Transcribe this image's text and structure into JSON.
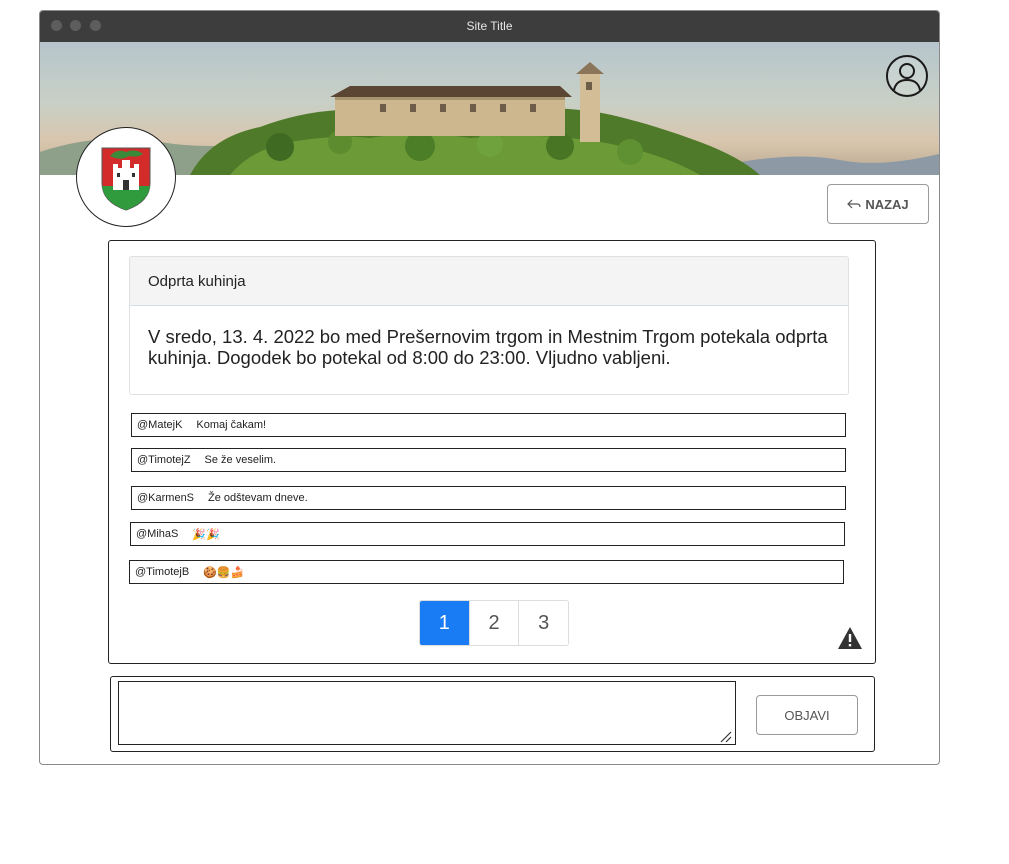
{
  "window": {
    "title": "Site Title"
  },
  "header": {
    "user_icon": "user-avatar-icon",
    "crest_icon": "ljubljana-coat-of-arms",
    "back_icon": "reply-arrow-icon",
    "back_label": "NAZAJ"
  },
  "post": {
    "title": "Odprta kuhinja",
    "body": "V sredo, 13. 4. 2022 bo med Prešernovim trgom in Mestnim Trgom potekala odprta kuhinja. Dogodek bo potekal od 8:00 do 23:00. Vljudno vabljeni."
  },
  "comments": [
    {
      "user": "@MatejK",
      "text": "Komaj čakam!"
    },
    {
      "user": "@TimotejZ",
      "text": "Se že veselim."
    },
    {
      "user": "@KarmenS",
      "text": "Že odštevam dneve."
    },
    {
      "user": "@MihaS",
      "text": "🎉🎉"
    },
    {
      "user": "@TimotejB",
      "text": "🍪🍔🍰"
    }
  ],
  "pagination": {
    "pages": [
      "1",
      "2",
      "3"
    ],
    "active": "1"
  },
  "report_icon": "warning-icon",
  "composer": {
    "value": "",
    "submit_label": "OBJAVI"
  },
  "colors": {
    "accent": "#1a7cf5",
    "titlebar": "#3d3d3d"
  }
}
